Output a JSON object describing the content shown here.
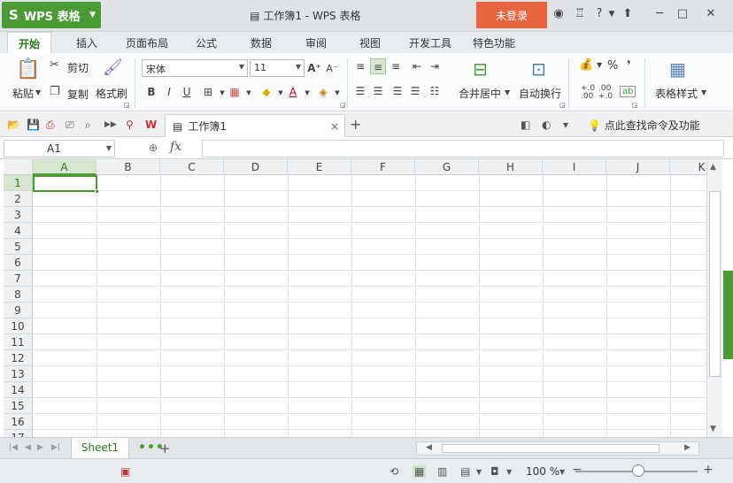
{
  "app": {
    "logo": "S",
    "name": "WPS 表格",
    "window_title": "工作簿1 - WPS 表格",
    "login_label": "未登录",
    "help_label": "?",
    "min_label": "─",
    "max_label": "□",
    "close_label": "✕"
  },
  "ribbon_tabs": [
    "开始",
    "插入",
    "页面布局",
    "公式",
    "数据",
    "审阅",
    "视图",
    "开发工具",
    "特色功能"
  ],
  "ribbon": {
    "paste": "粘贴",
    "cut": "剪切",
    "copy": "复制",
    "format_painter": "格式刷",
    "font_name": "宋体",
    "font_size": "11",
    "merge_center": "合并居中",
    "auto_wrap": "自动换行",
    "table_style": "表格样式",
    "percent": "%",
    "comma": "❜",
    "inc_decimal": ".0\n.00",
    "dec_decimal": ".00\n+.0"
  },
  "quickbar": {
    "doc_tab": "工作簿1",
    "find_command": "点此查找命令及功能"
  },
  "formula_bar": {
    "name_box": "A1",
    "fx": "fx",
    "formula": ""
  },
  "grid": {
    "columns": [
      "A",
      "B",
      "C",
      "D",
      "E",
      "F",
      "G",
      "H",
      "I",
      "J",
      "K"
    ],
    "rows": [
      "1",
      "2",
      "3",
      "4",
      "5",
      "6",
      "7",
      "8",
      "9",
      "10",
      "11",
      "12",
      "13",
      "14",
      "15",
      "16",
      "17"
    ],
    "active_cell": "A1"
  },
  "sheets": {
    "tabs": [
      "Sheet1"
    ],
    "more": "•••",
    "add": "+"
  },
  "status": {
    "zoom": "100 %"
  },
  "colors": {
    "accent_green": "#4a9b34",
    "login_orange": "#e8643c"
  }
}
